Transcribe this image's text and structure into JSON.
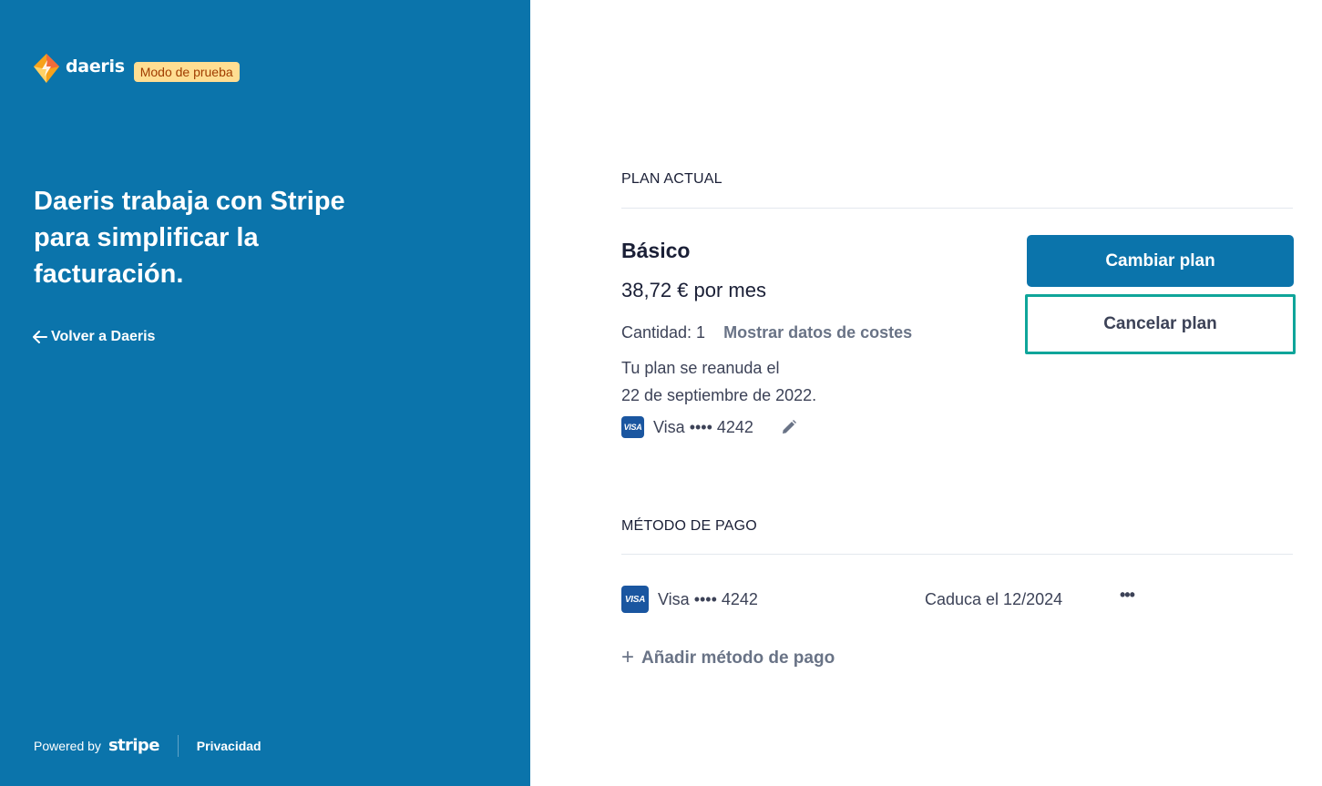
{
  "brand": {
    "name": "daeris",
    "test_badge": "Modo de prueba",
    "logo_colors": [
      "#f7a21b",
      "#f26b3a",
      "#ffd166"
    ]
  },
  "left": {
    "headline": "Daeris trabaja con Stripe para simplificar la facturación.",
    "back_link": "Volver a Daeris",
    "back_icon": "arrow-left-icon",
    "powered_by": "Powered by",
    "stripe_logo": "stripe",
    "privacy": "Privacidad",
    "background": "#0b74ab"
  },
  "current_plan": {
    "section_label": "PLAN ACTUAL",
    "plan_name": "Básico",
    "price": "38,72 € por mes",
    "quantity": "Cantidad: 1",
    "show_costs": "Mostrar datos de costes",
    "renew_line1": "Tu plan se reanuda el",
    "renew_line2": "22 de septiembre de 2022.",
    "card_brand_badge": "VISA",
    "card": "Visa •••• 4242",
    "edit_icon": "pencil-icon",
    "change_button": "Cambiar plan",
    "cancel_button": "Cancelar plan"
  },
  "payment_method": {
    "section_label": "MÉTODO DE PAGO",
    "card_brand_badge": "VISA",
    "card": "Visa •••• 4242",
    "expiry": "Caduca el 12/2024",
    "more_icon": "more-horizontal-icon",
    "more_label": "•••",
    "add_label": "Añadir método de pago",
    "add_icon": "plus-icon"
  },
  "colors": {
    "accent": "#0b74ab",
    "focus_ring": "#0fa59a",
    "muted_text": "#697386"
  }
}
